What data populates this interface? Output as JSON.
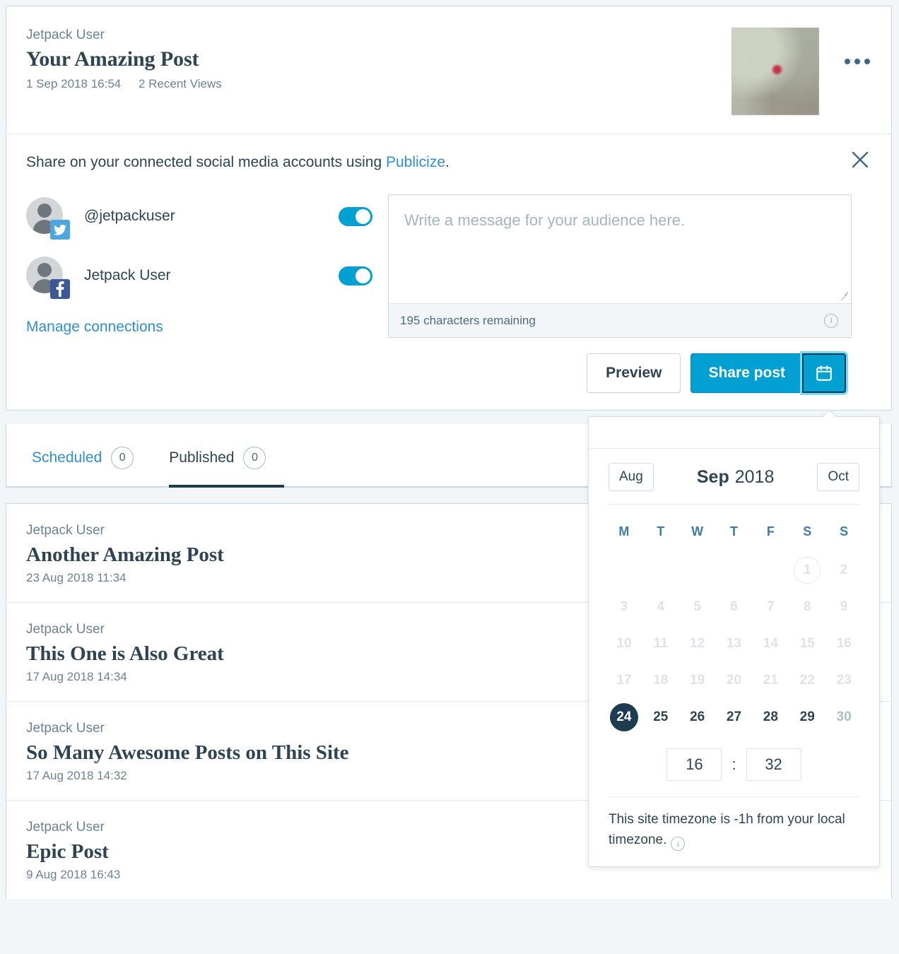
{
  "post": {
    "author": "Jetpack User",
    "title": "Your Amazing Post",
    "date": "1 Sep 2018 16:54",
    "views": "2 Recent Views",
    "thumbnail_name": "post-featured-image",
    "more_menu_label": "More options"
  },
  "publicize": {
    "intro_prefix": "Share on your connected social media accounts using ",
    "intro_link": "Publicize",
    "intro_suffix": ".",
    "close_label": "Close",
    "connections": [
      {
        "name": "@jetpackuser",
        "service": "twitter",
        "enabled": true
      },
      {
        "name": "Jetpack User",
        "service": "facebook",
        "enabled": true
      }
    ],
    "manage_link": "Manage connections",
    "message_placeholder": "Write a message for your audience here.",
    "message_value": "",
    "characters_remaining": "195 characters remaining",
    "info_glyph": "i"
  },
  "actions": {
    "preview_label": "Preview",
    "share_label": "Share post",
    "calendar_icon": "calendar-icon"
  },
  "calendar": {
    "prev_month": "Aug",
    "month": "Sep",
    "year": "2018",
    "next_month": "Oct",
    "weekdays": [
      "M",
      "T",
      "W",
      "T",
      "F",
      "S",
      "S"
    ],
    "weeks": [
      [
        {
          "label": "",
          "state": "empty"
        },
        {
          "label": "",
          "state": "empty"
        },
        {
          "label": "",
          "state": "empty"
        },
        {
          "label": "",
          "state": "empty"
        },
        {
          "label": "",
          "state": "empty"
        },
        {
          "label": "1",
          "state": "today-disabled"
        },
        {
          "label": "2",
          "state": "disabled"
        }
      ],
      [
        {
          "label": "3",
          "state": "disabled"
        },
        {
          "label": "4",
          "state": "disabled"
        },
        {
          "label": "5",
          "state": "disabled"
        },
        {
          "label": "6",
          "state": "disabled"
        },
        {
          "label": "7",
          "state": "disabled"
        },
        {
          "label": "8",
          "state": "disabled"
        },
        {
          "label": "9",
          "state": "disabled"
        }
      ],
      [
        {
          "label": "10",
          "state": "disabled"
        },
        {
          "label": "11",
          "state": "disabled"
        },
        {
          "label": "12",
          "state": "disabled"
        },
        {
          "label": "13",
          "state": "disabled"
        },
        {
          "label": "14",
          "state": "disabled"
        },
        {
          "label": "15",
          "state": "disabled"
        },
        {
          "label": "16",
          "state": "disabled"
        }
      ],
      [
        {
          "label": "17",
          "state": "disabled"
        },
        {
          "label": "18",
          "state": "disabled"
        },
        {
          "label": "19",
          "state": "disabled"
        },
        {
          "label": "20",
          "state": "disabled"
        },
        {
          "label": "21",
          "state": "disabled"
        },
        {
          "label": "22",
          "state": "disabled"
        },
        {
          "label": "23",
          "state": "disabled"
        }
      ],
      [
        {
          "label": "24",
          "state": "selected"
        },
        {
          "label": "25",
          "state": "enabled"
        },
        {
          "label": "26",
          "state": "enabled"
        },
        {
          "label": "27",
          "state": "enabled"
        },
        {
          "label": "28",
          "state": "enabled"
        },
        {
          "label": "29",
          "state": "enabled"
        },
        {
          "label": "30",
          "state": "dim"
        }
      ]
    ],
    "hour": "16",
    "minute": "32",
    "time_separator": ":",
    "timezone_note": "This site timezone is -1h from your local timezone.",
    "info_glyph": "i"
  },
  "tabs": [
    {
      "label": "Scheduled",
      "count": "0",
      "active": false
    },
    {
      "label": "Published",
      "count": "0",
      "active": true
    }
  ],
  "posts": [
    {
      "author": "Jetpack User",
      "title": "Another Amazing Post",
      "date": "23 Aug 2018 11:34"
    },
    {
      "author": "Jetpack User",
      "title": "This One is Also Great",
      "date": "17 Aug 2018 14:34"
    },
    {
      "author": "Jetpack User",
      "title": "So Many Awesome Posts on This Site",
      "date": "17 Aug 2018 14:32"
    },
    {
      "author": "Jetpack User",
      "title": "Epic Post",
      "date": "9 Aug 2018 16:43"
    }
  ],
  "colors": {
    "accent_blue": "#00a0d2",
    "link_blue": "#2e8fd0",
    "dark_navy": "#2e4453",
    "selected_day": "#1d3c50",
    "muted_text": "#6d8293",
    "page_bg": "#f3f6f8",
    "twitter": "#4da7de",
    "facebook": "#3b5998"
  }
}
